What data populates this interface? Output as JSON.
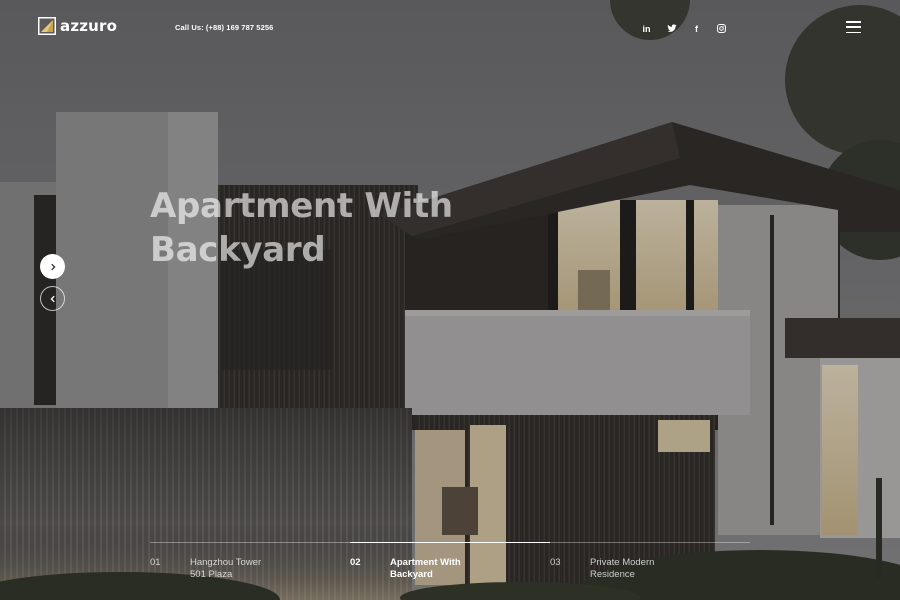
{
  "brand": {
    "name": "azzuro"
  },
  "header": {
    "call": "Call Us: (+88) 169 787 5256",
    "social": [
      {
        "icon": "linkedin-icon",
        "glyph": "in"
      },
      {
        "icon": "twitter-icon",
        "glyph": "t"
      },
      {
        "icon": "facebook-icon",
        "glyph": "f"
      },
      {
        "icon": "instagram-icon",
        "glyph": ""
      }
    ]
  },
  "hero": {
    "title_line1": "Apartment With",
    "title_line2": "Backyard"
  },
  "slides": [
    {
      "num": "01",
      "line1": "Hangzhou Tower",
      "line2": "501 Plaza",
      "active": false
    },
    {
      "num": "02",
      "line1": "Apartment With",
      "line2": "Backyard",
      "active": true
    },
    {
      "num": "03",
      "line1": "Private Modern",
      "line2": "Residence",
      "active": false
    }
  ],
  "colors": {
    "accent": "#c9a24a",
    "text": "#ffffff",
    "sky": "#6e6d70"
  }
}
